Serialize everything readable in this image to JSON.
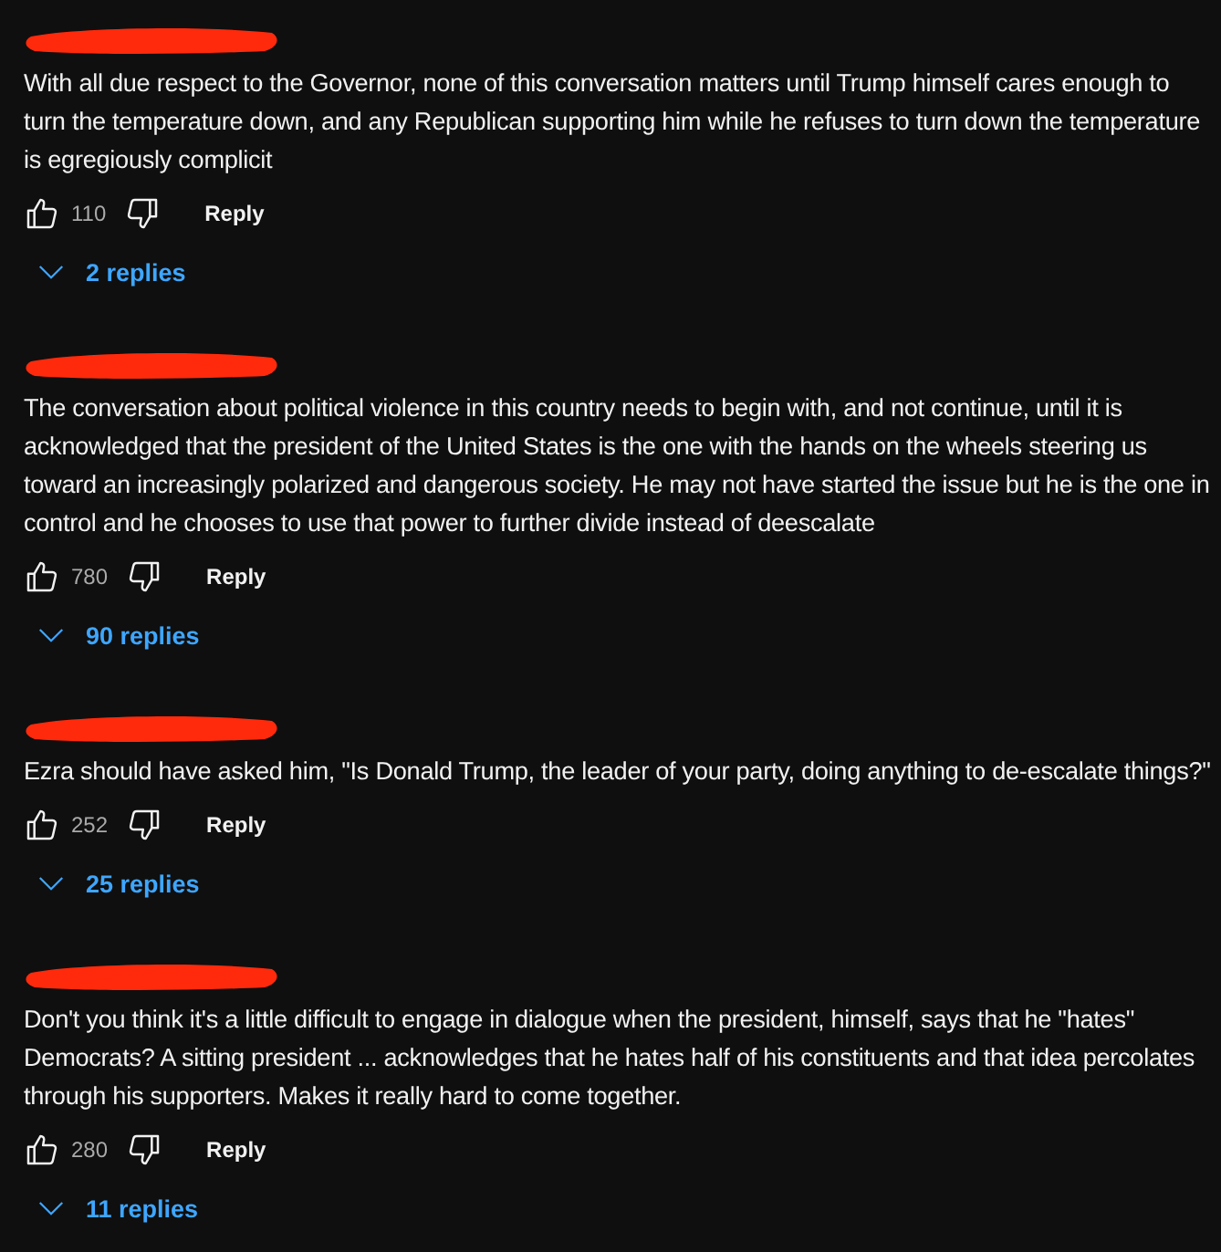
{
  "comments": [
    {
      "text": "With all due respect to the Governor, none of this conversation matters until Trump himself cares enough to turn the temperature down, and any Republican supporting him while he refuses to turn down the temperature is egregiously complicit",
      "likes": "110",
      "reply_button": "Reply",
      "replies": "2 replies"
    },
    {
      "text": "The conversation about political violence in this country needs to begin with, and not continue, until it is acknowledged that the president of the United States is the one with the hands on the wheels steering us toward an increasingly polarized and dangerous society. He may not have started the issue but he is the one in control and he chooses to use that power to further divide instead of deescalate",
      "likes": "780",
      "reply_button": "Reply",
      "replies": "90 replies"
    },
    {
      "text": "Ezra should have asked him, \"Is Donald Trump, the leader of your party, doing anything to de-escalate things?\"",
      "likes": "252",
      "reply_button": "Reply",
      "replies": "25 replies"
    },
    {
      "text": "Don't you think it's a little difficult to engage in dialogue when the president, himself, says that he \"hates\" Democrats? A sitting president ... acknowledges that he hates half of his constituents and that idea percolates through his supporters.  Makes it really hard to come together.",
      "likes": "280",
      "reply_button": "Reply",
      "replies": "11 replies"
    }
  ]
}
